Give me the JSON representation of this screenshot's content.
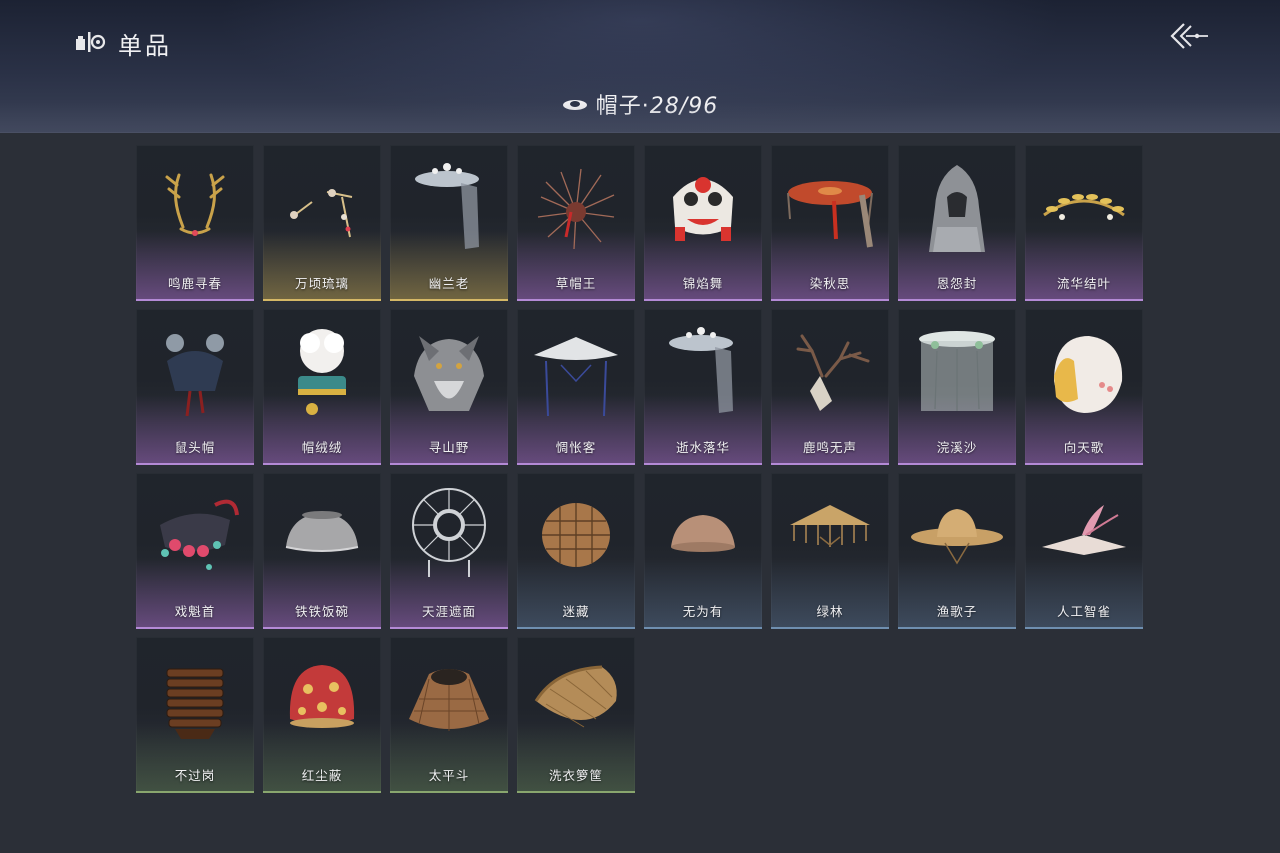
{
  "header": {
    "title": "单品",
    "category_name": "帽子",
    "separator": "·",
    "count": "28/96"
  },
  "icons": {
    "logo": "collection-logo-icon",
    "back": "back-arrow-icon",
    "category": "hat-icon"
  },
  "colors": {
    "background": "#2b2f37",
    "rarity_purple": "#b48ad6",
    "rarity_gold": "#d5b866",
    "rarity_blue": "#6f8fb0",
    "rarity_green": "#89a66e"
  },
  "items": [
    {
      "name": "鸣鹿寻春",
      "rarity": "purple",
      "art": "antler-crown"
    },
    {
      "name": "万顷琉璃",
      "rarity": "gold",
      "art": "jeweled-pins"
    },
    {
      "name": "幽兰老",
      "rarity": "gold",
      "art": "veiled-crown"
    },
    {
      "name": "草帽王",
      "rarity": "purple",
      "art": "feather-hat"
    },
    {
      "name": "锦焰舞",
      "rarity": "purple",
      "art": "lion-head"
    },
    {
      "name": "染秋思",
      "rarity": "purple",
      "art": "red-parasol-hat"
    },
    {
      "name": "恩怨封",
      "rarity": "purple",
      "art": "cloak-hood"
    },
    {
      "name": "流华结叶",
      "rarity": "purple",
      "art": "gold-leaf-circlet"
    },
    {
      "name": "鼠头帽",
      "rarity": "purple",
      "art": "mouse-hat"
    },
    {
      "name": "帽绒绒",
      "rarity": "purple",
      "art": "fluffy-hat"
    },
    {
      "name": "寻山野",
      "rarity": "purple",
      "art": "wolf-head"
    },
    {
      "name": "惆怅客",
      "rarity": "purple",
      "art": "veil-douli"
    },
    {
      "name": "逝水落华",
      "rarity": "purple",
      "art": "veiled-crown"
    },
    {
      "name": "鹿鸣无声",
      "rarity": "purple",
      "art": "deer-skull"
    },
    {
      "name": "浣溪沙",
      "rarity": "purple",
      "art": "sheer-veil"
    },
    {
      "name": "向天歌",
      "rarity": "purple",
      "art": "goose-hood"
    },
    {
      "name": "戏魁首",
      "rarity": "purple",
      "art": "opera-crown"
    },
    {
      "name": "铁铁饭碗",
      "rarity": "purple",
      "art": "metal-bowl"
    },
    {
      "name": "天涯遮面",
      "rarity": "purple",
      "art": "wire-hoop"
    },
    {
      "name": "迷藏",
      "rarity": "blue",
      "art": "woven-basket"
    },
    {
      "name": "无为有",
      "rarity": "blue",
      "art": "clay-bowl"
    },
    {
      "name": "绿林",
      "rarity": "blue",
      "art": "fringed-straw-hat"
    },
    {
      "name": "渔歌子",
      "rarity": "blue",
      "art": "straw-hat"
    },
    {
      "name": "人工智雀",
      "rarity": "blue",
      "art": "bird-hat"
    },
    {
      "name": "不过岗",
      "rarity": "green",
      "art": "stacked-bowls"
    },
    {
      "name": "红尘蔽",
      "rarity": "green",
      "art": "red-hood"
    },
    {
      "name": "太平斗",
      "rarity": "green",
      "art": "wicker-cone"
    },
    {
      "name": "洗衣箩筐",
      "rarity": "green",
      "art": "laundry-basket"
    }
  ]
}
